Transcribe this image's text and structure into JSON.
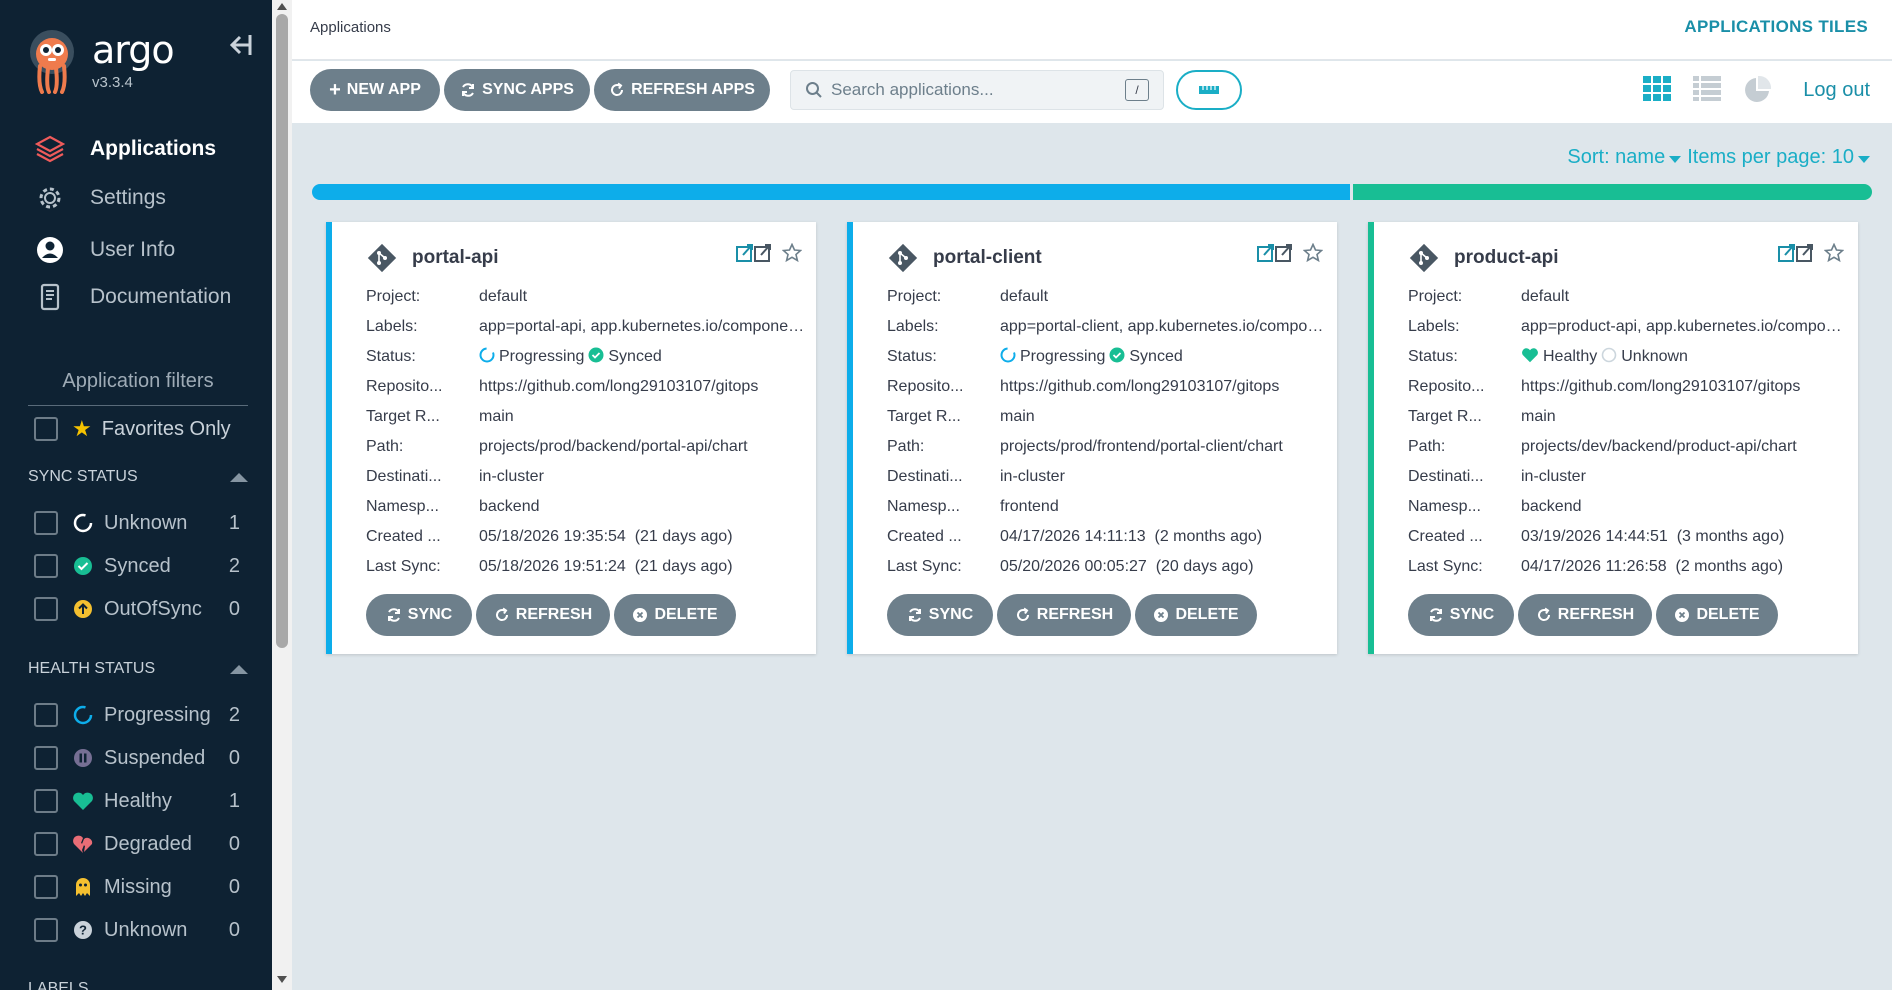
{
  "sidebar": {
    "brand": "argo",
    "version": "v3.3.4",
    "nav": [
      {
        "label": "Applications",
        "icon": "layers-icon"
      },
      {
        "label": "Settings",
        "icon": "gear-icon"
      },
      {
        "label": "User Info",
        "icon": "user-icon"
      },
      {
        "label": "Documentation",
        "icon": "book-icon"
      }
    ],
    "filters_title": "Application filters",
    "favorites_label": "Favorites Only",
    "sync_status_title": "SYNC STATUS",
    "sync_status": [
      {
        "label": "Unknown",
        "count": "1"
      },
      {
        "label": "Synced",
        "count": "2"
      },
      {
        "label": "OutOfSync",
        "count": "0"
      }
    ],
    "health_status_title": "HEALTH STATUS",
    "health_status": [
      {
        "label": "Progressing",
        "count": "2"
      },
      {
        "label": "Suspended",
        "count": "0"
      },
      {
        "label": "Healthy",
        "count": "1"
      },
      {
        "label": "Degraded",
        "count": "0"
      },
      {
        "label": "Missing",
        "count": "0"
      },
      {
        "label": "Unknown",
        "count": "0"
      }
    ],
    "labels_title": "LABELS"
  },
  "topbar": {
    "breadcrumb": "Applications",
    "view_title": "APPLICATIONS TILES"
  },
  "toolbar": {
    "new_app": "NEW APP",
    "sync_apps": "SYNC APPS",
    "refresh_apps": "REFRESH APPS",
    "search_placeholder": "Search applications...",
    "search_shortcut": "/",
    "logout": "Log out"
  },
  "sort": {
    "sort_label": "Sort: name",
    "items_label": "Items per page: 10"
  },
  "status_bar": {
    "progressing": 2,
    "healthy": 1,
    "progressing_color": "#0dadea",
    "healthy_color": "#18be94"
  },
  "colors": {
    "accent": "#1aaec6",
    "sidebar_bg": "#0e2233",
    "button_bg": "#6d7f8b",
    "progressing": "#0dadea",
    "synced": "#18be94",
    "healthy": "#18be94"
  },
  "card_labels": {
    "project": "Project:",
    "labels": "Labels:",
    "status": "Status:",
    "repository": "Reposito...",
    "target": "Target R...",
    "path": "Path:",
    "destination": "Destinati...",
    "namespace": "Namesp...",
    "created": "Created ...",
    "last_sync": "Last Sync:",
    "sync_btn": "SYNC",
    "refresh_btn": "REFRESH",
    "delete_btn": "DELETE"
  },
  "apps": [
    {
      "name": "portal-api",
      "project": "default",
      "labels": "app=portal-api, app.kubernetes.io/component=api,",
      "health": "Progressing",
      "sync": "Synced",
      "repository": "https://github.com/long29103107/gitops",
      "target": "main",
      "path": "projects/prod/backend/portal-api/chart",
      "destination": "in-cluster",
      "namespace": "backend",
      "created": "05/18/2026 19:35:54  (21 days ago)",
      "last_sync": "05/18/2026 19:51:24  (21 days ago)"
    },
    {
      "name": "portal-client",
      "project": "default",
      "labels": "app=portal-client, app.kubernetes.io/component=ui",
      "health": "Progressing",
      "sync": "Synced",
      "repository": "https://github.com/long29103107/gitops",
      "target": "main",
      "path": "projects/prod/frontend/portal-client/chart",
      "destination": "in-cluster",
      "namespace": "frontend",
      "created": "04/17/2026 14:11:13  (2 months ago)",
      "last_sync": "05/20/2026 00:05:27  (20 days ago)"
    },
    {
      "name": "product-api",
      "project": "default",
      "labels": "app=product-api, app.kubernetes.io/component=api",
      "health": "Healthy",
      "sync": "Unknown",
      "repository": "https://github.com/long29103107/gitops",
      "target": "main",
      "path": "projects/dev/backend/product-api/chart",
      "destination": "in-cluster",
      "namespace": "backend",
      "created": "03/19/2026 14:44:51  (3 months ago)",
      "last_sync": "04/17/2026 11:26:58  (2 months ago)"
    }
  ]
}
